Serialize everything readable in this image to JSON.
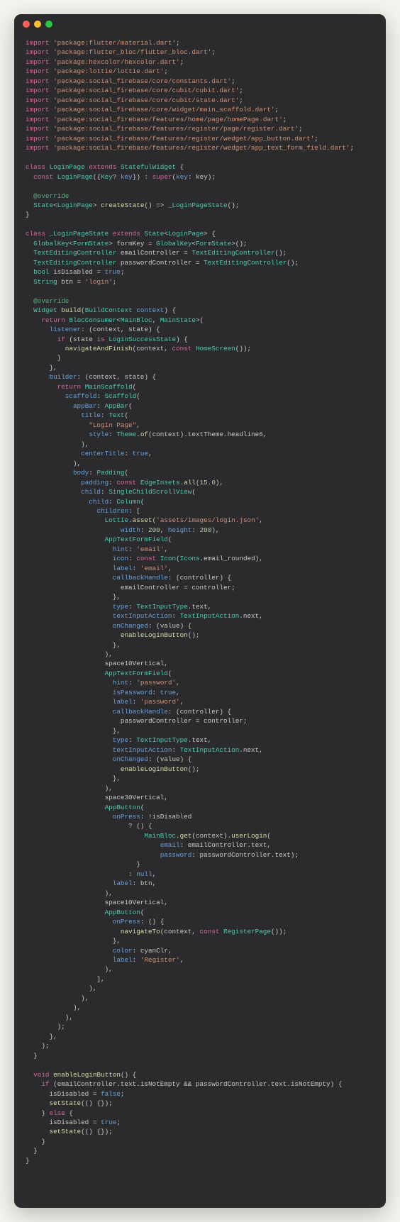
{
  "imports": [
    "'package:flutter/material.dart'",
    "'package:flutter_bloc/flutter_bloc.dart'",
    "'package:hexcolor/hexcolor.dart'",
    "'package:lottie/lottie.dart'",
    "'package:social_firebase/core/constants.dart'",
    "'package:social_firebase/core/cubit/cubit.dart'",
    "'package:social_firebase/core/cubit/state.dart'",
    "'package:social_firebase/core/widget/main_scaffold.dart'",
    "'package:social_firebase/features/home/page/homePage.dart'",
    "'package:social_firebase/features/register/page/register.dart'",
    "'package:social_firebase/features/register/wedget/app_button.dart'",
    "'package:social_firebase/features/register/wedget/app_text_form_field.dart'"
  ],
  "class1": {
    "name": "LoginPage",
    "extends": "StatefulWidget",
    "ctor": "const LoginPage({Key? key}) : super(key: key);",
    "override": "@override",
    "createState": "State<LoginPage> createState() => _LoginPageState();"
  },
  "class2": {
    "name": "_LoginPageState",
    "extends": "State<LoginPage>",
    "fields": {
      "formKey": "GlobalKey<FormState> formKey = GlobalKey<FormState>();",
      "emailCtrl": "TextEditingController emailController = TextEditingController();",
      "passCtrl": "TextEditingController passwordController = TextEditingController();",
      "isDisabled": "bool isDisabled = true;",
      "btn": "String btn = 'login';"
    },
    "override": "@override",
    "buildSig": "Widget build(BuildContext context) {",
    "blocConsumer": "BlocConsumer<MainBloc, MainState>",
    "listenerSig": "listener: (context, state) {",
    "ifLogin": "if (state is LoginSuccessState) {",
    "navFinish": "navigateAndFinish(context, const HomeScreen());",
    "builderSig": "builder: (context, state) {",
    "mainScaffold": "MainScaffold",
    "scaffold": "Scaffold",
    "appBar": "AppBar",
    "titleText": "\"Login Page\"",
    "style": "Theme.of(context).textTheme.headline6",
    "centerTitle": "true",
    "padding": "Padding",
    "edgeInsets": "const EdgeInsets.all(15.0)",
    "scrollView": "SingleChildScrollView",
    "column": "Column",
    "lottie": "Lottie.asset('assets/images/login.json',",
    "lottieSize": "width: 200, height: 200),",
    "appTextForm": "AppTextFormField",
    "hintEmail": "'email'",
    "iconEmail": "const Icon(Icons.email_rounded)",
    "labelEmail": "'email'",
    "callbackHandle": "callbackHandle: (controller) {",
    "emailAssign": "emailController = controller;",
    "typeText": "TextInputType.text",
    "actionNext": "TextInputAction.next",
    "onChanged": "onChanged: (value) {",
    "enableBtn": "enableLoginButton();",
    "space10": "space10Vertical",
    "hintPass": "'password'",
    "isPassword": "true",
    "labelPass": "'password'",
    "passAssign": "passwordController = controller;",
    "space30": "space30Vertical",
    "appButton": "AppButton",
    "onPressDisabled": "onPress: !isDisabled",
    "ternary": "? () {",
    "mainBlocGet": "MainBloc.get(context).userLogin(",
    "emailParam": "email: emailController.text,",
    "passParam": "password: passwordController.text);",
    "nullVal": ": null,",
    "labelBtn": "label: btn,",
    "onPressReg": "onPress: () {",
    "navTo": "navigateTo(context, const RegisterPage());",
    "colorCyan": "color: cyanClr,",
    "labelReg": "label: 'Register',"
  },
  "method": {
    "sig": "void enableLoginButton() {",
    "ifCond": "if (emailController.text.isNotEmpty && passwordController.text.isNotEmpty) {",
    "disFalse": "isDisabled = false;",
    "setState": "setState(() {});",
    "elseKw": "} else {",
    "disTrue": "isDisabled = true;"
  }
}
